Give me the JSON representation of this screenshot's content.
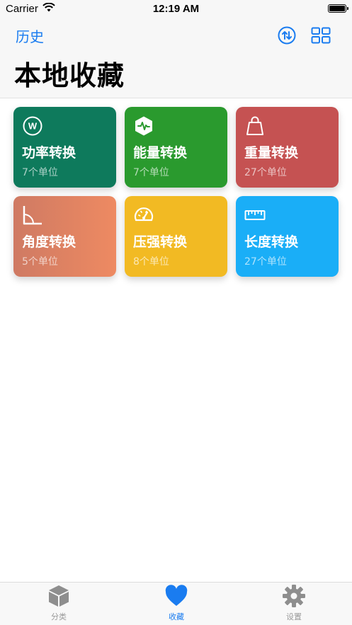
{
  "status_bar": {
    "carrier": "Carrier",
    "time": "12:19 AM"
  },
  "nav": {
    "back_label": "历史",
    "title": "本地收藏",
    "accent": "#1a7cf0"
  },
  "cards": [
    {
      "title": "功率转换",
      "subtitle": "7个单位",
      "icon": "watt-icon",
      "color": "#0e7a5c"
    },
    {
      "title": "能量转换",
      "subtitle": "7个单位",
      "icon": "energy-hexagon-icon",
      "color": "#2a9a2e"
    },
    {
      "title": "重量转换",
      "subtitle": "27个单位",
      "icon": "weight-bag-icon",
      "color": "#c55252"
    },
    {
      "title": "角度转换",
      "subtitle": "5个单位",
      "icon": "angle-icon",
      "color": "#e07e5c"
    },
    {
      "title": "压强转换",
      "subtitle": "8个单位",
      "icon": "gauge-icon",
      "color": "#f2ba23"
    },
    {
      "title": "长度转换",
      "subtitle": "27个单位",
      "icon": "ruler-icon",
      "color": "#1aaef7"
    }
  ],
  "tabs": [
    {
      "label": "分类",
      "icon": "cube-icon",
      "active": false
    },
    {
      "label": "收藏",
      "icon": "heart-icon",
      "active": true
    },
    {
      "label": "设置",
      "icon": "gear-icon",
      "active": false
    }
  ]
}
